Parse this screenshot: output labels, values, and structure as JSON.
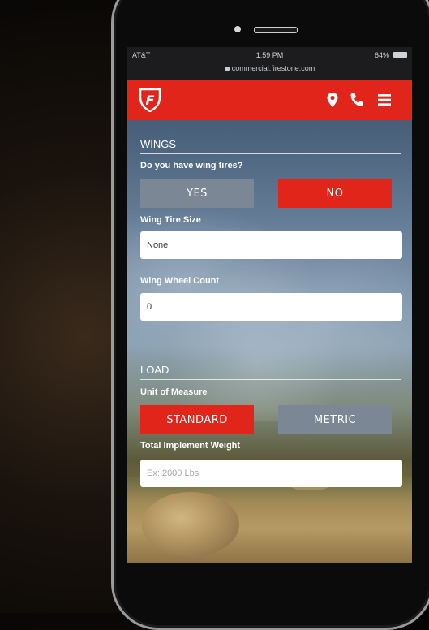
{
  "status_bar": {
    "carrier": "AT&T",
    "time": "1:59 PM",
    "battery": "64%",
    "url": "commercial.firestone.com"
  },
  "navbar": {
    "logo": "F",
    "icons": [
      "location-pin-icon",
      "phone-icon",
      "hamburger-menu-icon"
    ]
  },
  "wings": {
    "title": "WINGS",
    "question": "Do you have wing tires?",
    "yes_label": "YES",
    "no_label": "NO",
    "tire_size_label": "Wing Tire Size",
    "tire_size_value": "None",
    "wheel_count_label": "Wing Wheel Count",
    "wheel_count_value": "0"
  },
  "load": {
    "title": "LOAD",
    "unit_label": "Unit of Measure",
    "standard_label": "STANDARD",
    "metric_label": "METRIC",
    "weight_label": "Total Implement Weight",
    "weight_placeholder": "Ex: 2000 Lbs"
  },
  "colors": {
    "brand_red": "#e1251b",
    "inactive_grey": "#7b8794"
  }
}
